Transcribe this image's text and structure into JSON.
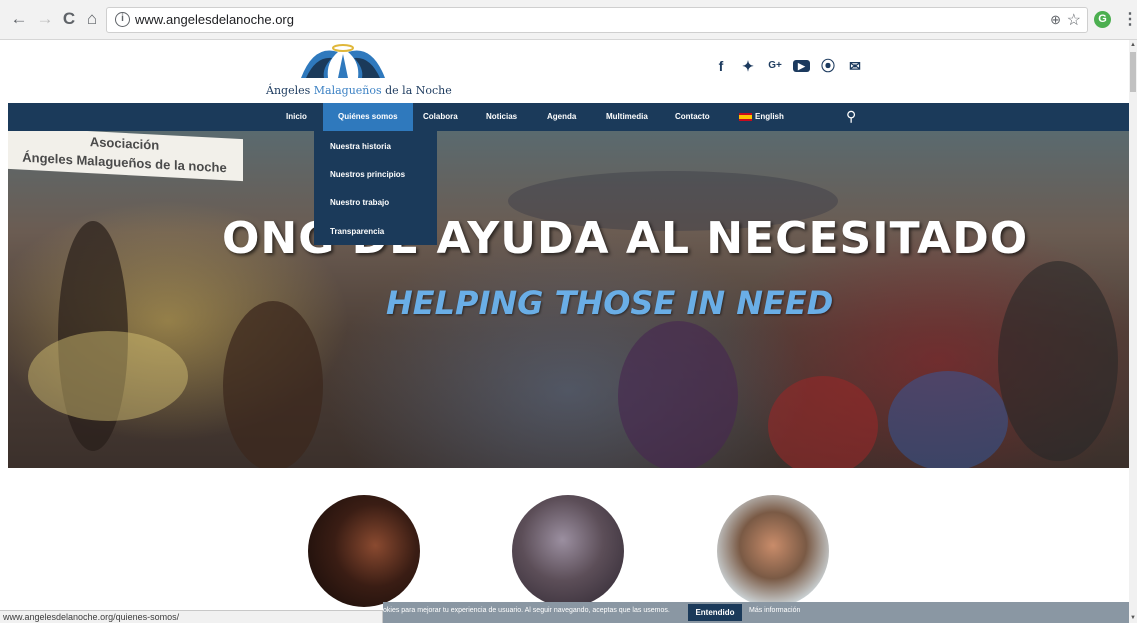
{
  "browser": {
    "url": "www.angelesdelanoche.org",
    "back_icon": "←",
    "forward_icon": "→",
    "reload_icon": "C",
    "home_icon": "⌂",
    "info_icon": "i",
    "zoom_icon": "⊕",
    "star_icon": "☆",
    "extension_label": "G",
    "menu_icon": "⋮"
  },
  "logo": {
    "name_first": "Ángeles ",
    "name_accent": "Malagueños",
    "name_last": " de la Noche"
  },
  "social": {
    "facebook": "f",
    "twitter": "✦",
    "google": "G+",
    "youtube": "▶",
    "rss": "⦿",
    "email": "✉"
  },
  "nav": {
    "items": [
      {
        "label": "Inicio"
      },
      {
        "label": "Quiénes somos"
      },
      {
        "label": "Colabora"
      },
      {
        "label": "Noticias"
      },
      {
        "label": "Agenda"
      },
      {
        "label": "Multimedia"
      },
      {
        "label": "Contacto"
      },
      {
        "label": "English"
      }
    ],
    "search_icon": "⚲"
  },
  "dropdown": {
    "items": [
      {
        "label": "Nuestra historia"
      },
      {
        "label": "Nuestros principios"
      },
      {
        "label": "Nuestro trabajo"
      },
      {
        "label": "Transparencia"
      }
    ]
  },
  "hero": {
    "banner_line1": "Asociación",
    "banner_line2": "Ángeles Malagueños de la noche",
    "title": "ONG DE AYUDA AL NECESITADO",
    "subtitle": "HELPING THOSE IN NEED"
  },
  "cookie": {
    "message": "okies para mejorar tu experiencia de usuario. Al seguir navegando, aceptas que las usemos.",
    "accept_label": "Entendido",
    "more_label": "Más información"
  },
  "status": {
    "link": "www.angelesdelanoche.org/quienes-somos/"
  },
  "colors": {
    "navbar": "#1b3a5a",
    "active": "#2f79bd",
    "cookie_bar": "#8a97a3"
  }
}
